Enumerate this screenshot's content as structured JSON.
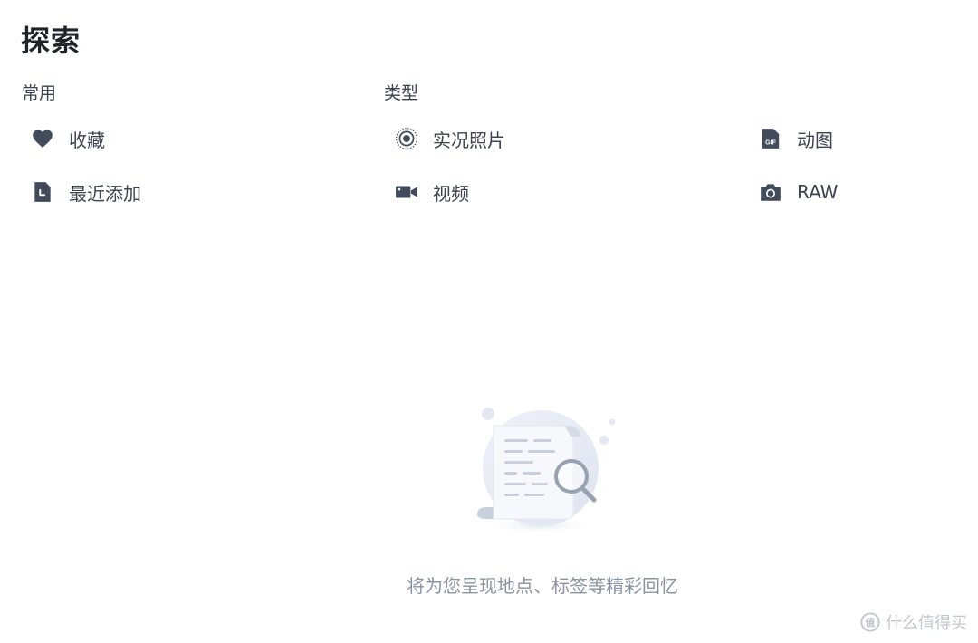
{
  "page": {
    "title": "探索"
  },
  "sections": {
    "common": {
      "label": "常用",
      "items": [
        {
          "label": "收藏",
          "icon": "heart-icon"
        },
        {
          "label": "最近添加",
          "icon": "recent-file-icon"
        }
      ]
    },
    "types": {
      "label": "类型",
      "items": [
        {
          "label": "实况照片",
          "icon": "live-photo-icon"
        },
        {
          "label": "动图",
          "icon": "gif-icon"
        },
        {
          "label": "视频",
          "icon": "video-camera-icon"
        },
        {
          "label": "RAW",
          "icon": "camera-icon"
        }
      ]
    }
  },
  "empty_state": {
    "message": "将为您呈现地点、标签等精彩回忆",
    "icon": "document-search-illustration"
  },
  "watermark": {
    "text": "什么值得买",
    "icon": "smzdm-logo"
  },
  "colors": {
    "icon": "#414b5b",
    "text": "#3c4350",
    "title": "#1f2329",
    "muted": "#8a93a3",
    "illustration_circle": "#e6eaf3",
    "illustration_accent": "#98a2b3"
  }
}
